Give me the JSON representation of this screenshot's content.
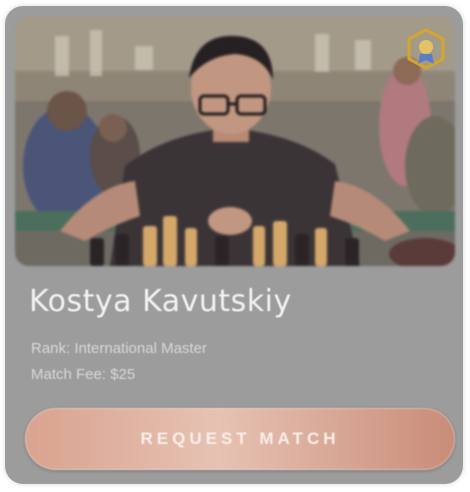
{
  "profile": {
    "name": "Kostya Kavutskiy",
    "rank": "Rank: International Master",
    "fee": "Match Fee: $25"
  },
  "actions": {
    "request_label": "REQUEST MATCH"
  },
  "colors": {
    "card": "#9c9c9c",
    "button_start": "#d9a38f",
    "button_end": "#c98c78",
    "badge": "#d4a62a"
  },
  "icons": {
    "badge": "award-badge-icon"
  }
}
